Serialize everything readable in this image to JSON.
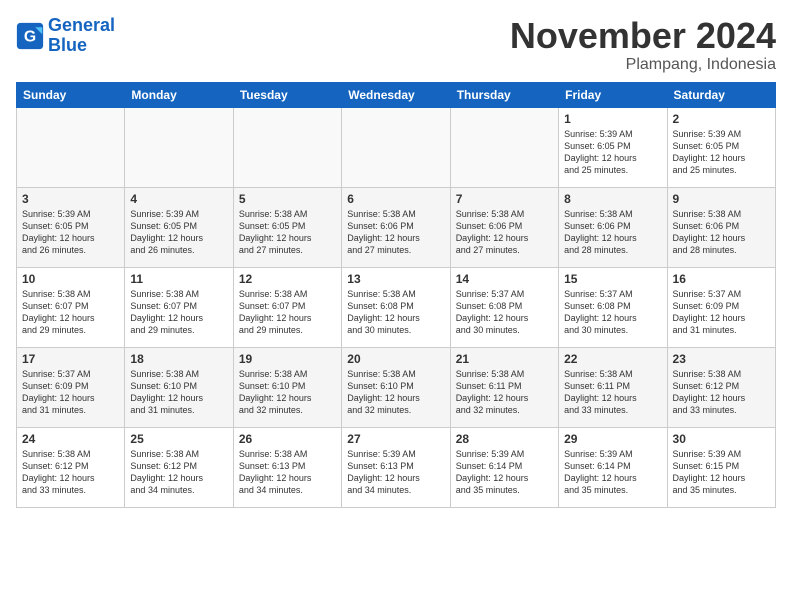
{
  "header": {
    "logo_line1": "General",
    "logo_line2": "Blue",
    "month_title": "November 2024",
    "location": "Plampang, Indonesia"
  },
  "weekdays": [
    "Sunday",
    "Monday",
    "Tuesday",
    "Wednesday",
    "Thursday",
    "Friday",
    "Saturday"
  ],
  "weeks": [
    [
      {
        "day": "",
        "info": ""
      },
      {
        "day": "",
        "info": ""
      },
      {
        "day": "",
        "info": ""
      },
      {
        "day": "",
        "info": ""
      },
      {
        "day": "",
        "info": ""
      },
      {
        "day": "1",
        "info": "Sunrise: 5:39 AM\nSunset: 6:05 PM\nDaylight: 12 hours\nand 25 minutes."
      },
      {
        "day": "2",
        "info": "Sunrise: 5:39 AM\nSunset: 6:05 PM\nDaylight: 12 hours\nand 25 minutes."
      }
    ],
    [
      {
        "day": "3",
        "info": "Sunrise: 5:39 AM\nSunset: 6:05 PM\nDaylight: 12 hours\nand 26 minutes."
      },
      {
        "day": "4",
        "info": "Sunrise: 5:39 AM\nSunset: 6:05 PM\nDaylight: 12 hours\nand 26 minutes."
      },
      {
        "day": "5",
        "info": "Sunrise: 5:38 AM\nSunset: 6:05 PM\nDaylight: 12 hours\nand 27 minutes."
      },
      {
        "day": "6",
        "info": "Sunrise: 5:38 AM\nSunset: 6:06 PM\nDaylight: 12 hours\nand 27 minutes."
      },
      {
        "day": "7",
        "info": "Sunrise: 5:38 AM\nSunset: 6:06 PM\nDaylight: 12 hours\nand 27 minutes."
      },
      {
        "day": "8",
        "info": "Sunrise: 5:38 AM\nSunset: 6:06 PM\nDaylight: 12 hours\nand 28 minutes."
      },
      {
        "day": "9",
        "info": "Sunrise: 5:38 AM\nSunset: 6:06 PM\nDaylight: 12 hours\nand 28 minutes."
      }
    ],
    [
      {
        "day": "10",
        "info": "Sunrise: 5:38 AM\nSunset: 6:07 PM\nDaylight: 12 hours\nand 29 minutes."
      },
      {
        "day": "11",
        "info": "Sunrise: 5:38 AM\nSunset: 6:07 PM\nDaylight: 12 hours\nand 29 minutes."
      },
      {
        "day": "12",
        "info": "Sunrise: 5:38 AM\nSunset: 6:07 PM\nDaylight: 12 hours\nand 29 minutes."
      },
      {
        "day": "13",
        "info": "Sunrise: 5:38 AM\nSunset: 6:08 PM\nDaylight: 12 hours\nand 30 minutes."
      },
      {
        "day": "14",
        "info": "Sunrise: 5:37 AM\nSunset: 6:08 PM\nDaylight: 12 hours\nand 30 minutes."
      },
      {
        "day": "15",
        "info": "Sunrise: 5:37 AM\nSunset: 6:08 PM\nDaylight: 12 hours\nand 30 minutes."
      },
      {
        "day": "16",
        "info": "Sunrise: 5:37 AM\nSunset: 6:09 PM\nDaylight: 12 hours\nand 31 minutes."
      }
    ],
    [
      {
        "day": "17",
        "info": "Sunrise: 5:37 AM\nSunset: 6:09 PM\nDaylight: 12 hours\nand 31 minutes."
      },
      {
        "day": "18",
        "info": "Sunrise: 5:38 AM\nSunset: 6:10 PM\nDaylight: 12 hours\nand 31 minutes."
      },
      {
        "day": "19",
        "info": "Sunrise: 5:38 AM\nSunset: 6:10 PM\nDaylight: 12 hours\nand 32 minutes."
      },
      {
        "day": "20",
        "info": "Sunrise: 5:38 AM\nSunset: 6:10 PM\nDaylight: 12 hours\nand 32 minutes."
      },
      {
        "day": "21",
        "info": "Sunrise: 5:38 AM\nSunset: 6:11 PM\nDaylight: 12 hours\nand 32 minutes."
      },
      {
        "day": "22",
        "info": "Sunrise: 5:38 AM\nSunset: 6:11 PM\nDaylight: 12 hours\nand 33 minutes."
      },
      {
        "day": "23",
        "info": "Sunrise: 5:38 AM\nSunset: 6:12 PM\nDaylight: 12 hours\nand 33 minutes."
      }
    ],
    [
      {
        "day": "24",
        "info": "Sunrise: 5:38 AM\nSunset: 6:12 PM\nDaylight: 12 hours\nand 33 minutes."
      },
      {
        "day": "25",
        "info": "Sunrise: 5:38 AM\nSunset: 6:12 PM\nDaylight: 12 hours\nand 34 minutes."
      },
      {
        "day": "26",
        "info": "Sunrise: 5:38 AM\nSunset: 6:13 PM\nDaylight: 12 hours\nand 34 minutes."
      },
      {
        "day": "27",
        "info": "Sunrise: 5:39 AM\nSunset: 6:13 PM\nDaylight: 12 hours\nand 34 minutes."
      },
      {
        "day": "28",
        "info": "Sunrise: 5:39 AM\nSunset: 6:14 PM\nDaylight: 12 hours\nand 35 minutes."
      },
      {
        "day": "29",
        "info": "Sunrise: 5:39 AM\nSunset: 6:14 PM\nDaylight: 12 hours\nand 35 minutes."
      },
      {
        "day": "30",
        "info": "Sunrise: 5:39 AM\nSunset: 6:15 PM\nDaylight: 12 hours\nand 35 minutes."
      }
    ]
  ]
}
